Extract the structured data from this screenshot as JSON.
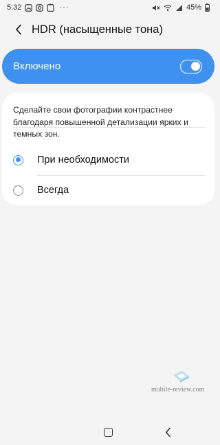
{
  "status_bar": {
    "time": "5:32",
    "battery_percent": "45%",
    "overflow": "···",
    "icons": [
      "gallery-icon",
      "instagram-icon",
      "clipboard-icon",
      "mute-icon",
      "vowifi-icon",
      "signal-icon",
      "battery-icon"
    ]
  },
  "header": {
    "title": "HDR (насыщенные тона)"
  },
  "master_switch": {
    "label": "Включено",
    "state": "on",
    "accent_color": "#3e91ef"
  },
  "settings": {
    "description": "Сделайте свои фотографии контрастнее благодаря повышенной детализации ярких и темных зон.",
    "options": [
      {
        "label": "При необходимости",
        "checked": true
      },
      {
        "label": "Всегда",
        "checked": false
      }
    ]
  },
  "watermark": {
    "text": "mobile-review.com"
  },
  "nav_bar": {
    "buttons": [
      "recents-icon",
      "home-icon",
      "back-icon"
    ]
  }
}
